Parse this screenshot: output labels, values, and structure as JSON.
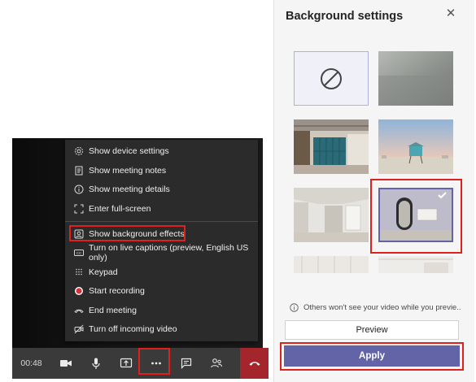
{
  "meeting": {
    "menu": {
      "items": [
        {
          "label": "Show device settings",
          "icon": "gear-icon"
        },
        {
          "label": "Show meeting notes",
          "icon": "notes-icon"
        },
        {
          "label": "Show meeting details",
          "icon": "info-icon"
        },
        {
          "label": "Enter full-screen",
          "icon": "fullscreen-icon"
        },
        {
          "label": "Show background effects",
          "icon": "background-effects-icon"
        },
        {
          "label": "Turn on live captions (preview, English US only)",
          "icon": "captions-icon"
        },
        {
          "label": "Keypad",
          "icon": "keypad-icon"
        },
        {
          "label": "Start recording",
          "icon": "record-icon"
        },
        {
          "label": "End meeting",
          "icon": "end-call-icon"
        },
        {
          "label": "Turn off incoming video",
          "icon": "video-off-icon"
        }
      ]
    },
    "toolbar": {
      "time": "00:48",
      "buttons": [
        "camera-icon",
        "microphone-icon",
        "share-icon",
        "more-options-icon",
        "chat-icon",
        "participants-icon",
        "hang-up-icon"
      ]
    },
    "colors": {
      "highlight": "#e0201c",
      "hangup": "#a4262c"
    }
  },
  "panel": {
    "title": "Background settings",
    "close_icon": "close-icon",
    "thumbnails": [
      "none",
      "blur",
      "office-lockers",
      "beach-lifeguard-tower",
      "white-room",
      "mirror-room",
      "partial-room-1",
      "partial-room-2"
    ],
    "selected_index": 5,
    "info_text": "Others won't see your video while you previe...",
    "preview_label": "Preview",
    "apply_label": "Apply",
    "colors": {
      "accent": "#6264a7"
    }
  }
}
